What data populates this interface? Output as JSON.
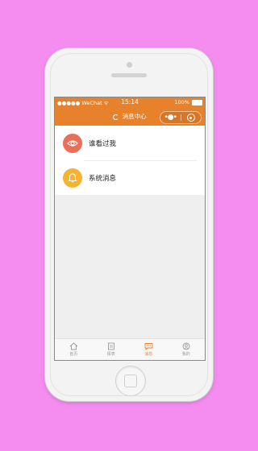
{
  "status_bar": {
    "carrier": "●●●●● WeChat",
    "time": "15:14",
    "battery": "100%"
  },
  "nav": {
    "title": "消息中心",
    "more_icon": "more-dots-icon",
    "close_icon": "target-close-icon"
  },
  "list": {
    "items": [
      {
        "label": "谁看过我",
        "icon": "eye-icon",
        "color": "#ea6f57"
      },
      {
        "label": "系统消息",
        "icon": "bell-icon",
        "color": "#f6b331"
      }
    ]
  },
  "tabs": [
    {
      "label": "首页",
      "icon": "home-icon",
      "active": false
    },
    {
      "label": "报表",
      "icon": "report-icon",
      "active": false
    },
    {
      "label": "消息",
      "icon": "message-icon",
      "active": true
    },
    {
      "label": "我的",
      "icon": "user-icon",
      "active": false
    }
  ],
  "colors": {
    "accent": "#e8812c",
    "background": "#f58df0",
    "tab_active": "#e8812c",
    "tab_inactive": "#9a9a9a"
  }
}
